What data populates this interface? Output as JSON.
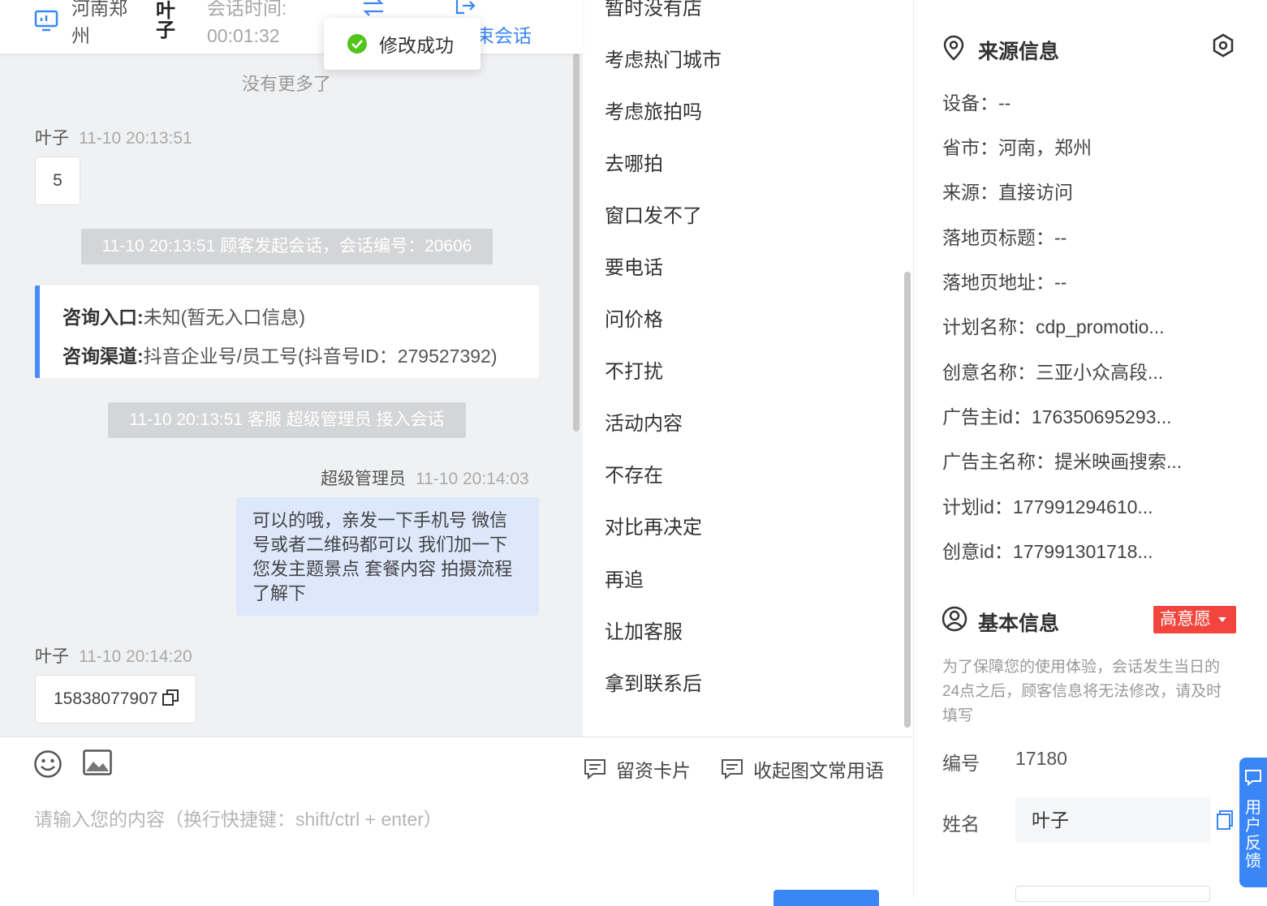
{
  "header": {
    "location": "河南郑州",
    "location_line1": "河南郑",
    "location_line2": "州",
    "customer_name": "叶子",
    "session_time_label": "会话时间:",
    "session_time_value": "00:01:32",
    "end_session_partial": "束会话"
  },
  "toast": {
    "text": "修改成功"
  },
  "chat": {
    "no_more": "没有更多了",
    "messages": [
      {
        "sender": "叶子",
        "time": "11-10 20:13:51",
        "text": "5"
      },
      {
        "system": "11-10 20:13:51 顾客发起会话，会话编号：20606"
      },
      {
        "system": "11-10 20:13:51 客服 超级管理员 接入会话"
      },
      {
        "sender": "超级管理员",
        "time": "11-10 20:14:03",
        "text": "可以的哦，亲发一下手机号 微信号或者二维码都可以 我们加一下您发主题景点 套餐内容 拍摄流程了解下"
      },
      {
        "sender": "叶子",
        "time": "11-10 20:14:20",
        "text": "15838077907"
      }
    ],
    "info_card": {
      "entry_label": "咨询入口:",
      "entry_value": "未知(暂无入口信息)",
      "channel_label": "咨询渠道:",
      "channel_value": "抖音企业号/员工号(抖音号ID：279527392)"
    }
  },
  "input": {
    "placeholder": "请输入您的内容（换行快捷键：shift/ctrl + enter）",
    "lead_card_label": "留资卡片",
    "collapse_label": "收起图文常用语"
  },
  "phrases": {
    "items": [
      "暂时没有店",
      "考虑热门城市",
      "考虑旅拍吗",
      "去哪拍",
      "窗口发不了",
      "要电话",
      "问价格",
      "不打扰",
      "活动内容",
      "不存在",
      "对比再决定",
      "再追",
      "让加客服",
      "拿到联系后"
    ]
  },
  "source_info": {
    "title": "来源信息",
    "rows": [
      "设备：--",
      "省市：河南，郑州",
      "来源：直接访问",
      "落地页标题：--",
      "落地页地址：--",
      "计划名称：cdp_promotio...",
      "创意名称：三亚小众高段...",
      "广告主id：176350695293...",
      "广告主名称：提米映画搜索...",
      "计划id：177991294610...",
      "创意id：177991301718..."
    ]
  },
  "basic_info": {
    "title": "基本信息",
    "intent_badge": "高意愿",
    "note": "为了保障您的使用体验，会话发生当日的24点之后，顾客信息将无法修改，请及时填写",
    "id_label": "编号",
    "id_value": "17180",
    "name_label": "姓名",
    "name_value": "叶子"
  },
  "feedback": {
    "label": "用户反馈"
  },
  "colors": {
    "accent": "#3a86f7",
    "badge": "#f2453d",
    "success": "#52c41a"
  }
}
